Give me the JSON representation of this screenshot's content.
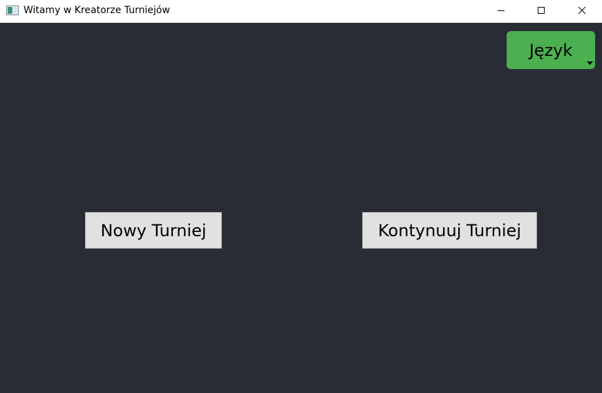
{
  "window": {
    "title": "Witamy w Kreatorze Turniejów",
    "icon": "app-window-icon",
    "controls": {
      "minimize_icon": "minimize-icon",
      "maximize_icon": "maximize-icon",
      "close_icon": "close-icon"
    }
  },
  "colors": {
    "background": "#292c34",
    "accent": "#4caf50",
    "button_face": "#e1e1e1"
  },
  "language_selector": {
    "label": "Język",
    "icon": "dropdown-arrow-icon"
  },
  "actions": {
    "new_tournament": "Nowy Turniej",
    "continue_tournament": "Kontynuuj Turniej"
  }
}
